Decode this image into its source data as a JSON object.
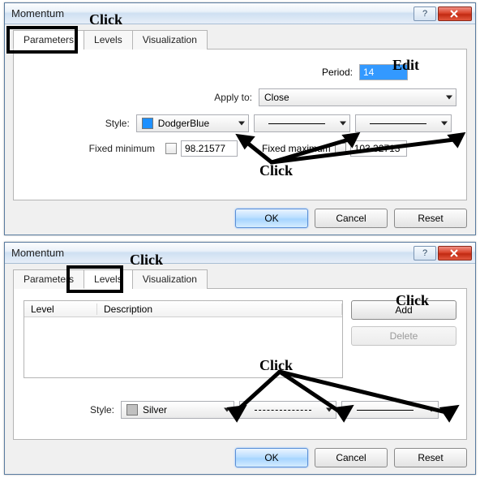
{
  "dialog1": {
    "title": "Momentum",
    "tabs": {
      "parameters": "Parameters",
      "levels": "Levels",
      "visualization": "Visualization"
    },
    "period_label": "Period:",
    "period_value": "14",
    "apply_label": "Apply to:",
    "apply_value": "Close",
    "style_label": "Style:",
    "style_color_name": "DodgerBlue",
    "style_color_hex": "#1e90ff",
    "fixed_min_label": "Fixed minimum",
    "fixed_min_value": "98.21577",
    "fixed_max_label": "Fixed maximum",
    "fixed_max_value": "103.32713",
    "ok": "OK",
    "cancel": "Cancel",
    "reset": "Reset"
  },
  "dialog2": {
    "title": "Momentum",
    "tabs": {
      "parameters": "Parameters",
      "levels": "Levels",
      "visualization": "Visualization"
    },
    "col_level": "Level",
    "col_desc": "Description",
    "add": "Add",
    "delete": "Delete",
    "style_label": "Style:",
    "style_color_name": "Silver",
    "style_color_hex": "#c0c0c0",
    "ok": "OK",
    "cancel": "Cancel",
    "reset": "Reset"
  },
  "annotations": {
    "click": "Click",
    "edit": "Edit"
  }
}
